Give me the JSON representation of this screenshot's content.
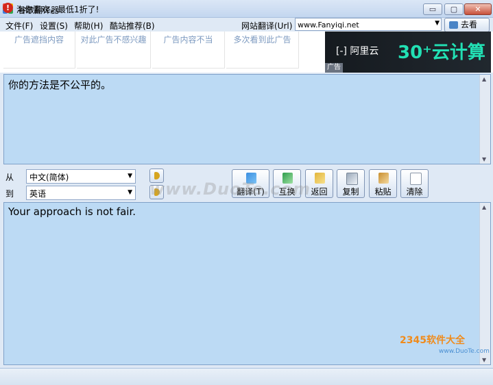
{
  "window": {
    "title": "谷歌翻译器",
    "controls": {
      "minimize": "▭",
      "restore": "▢",
      "close": "✕"
    }
  },
  "menu": {
    "items": [
      "文件(F)",
      "设置(S)",
      "帮助(H)",
      "酷站推荐(B)"
    ],
    "url_label": "网站翻译(Url)",
    "url_value": "www.Fanyiqi.net",
    "go_label": "去看"
  },
  "ads": {
    "links": [
      "广告遮挡内容",
      "对此广告不感兴趣",
      "广告内容不当",
      "多次看到此广告"
    ],
    "banner_logo": "[-] 阿里云",
    "banner_headline": "30⁺云计算",
    "tag": "广告"
  },
  "source": {
    "text": "你的方法是不公平的。"
  },
  "languages": {
    "from_label": "从",
    "to_label": "到",
    "from_value": "中文(简体)",
    "to_value": "英语"
  },
  "toolbar": {
    "buttons": [
      {
        "label": "翻译(T)",
        "icon": "translate-icon"
      },
      {
        "label": "互换",
        "icon": "swap-icon"
      },
      {
        "label": "返回",
        "icon": "back-icon"
      },
      {
        "label": "复制",
        "icon": "copy-icon"
      },
      {
        "label": "粘贴",
        "icon": "paste-icon"
      },
      {
        "label": "清除",
        "icon": "clear-icon"
      }
    ]
  },
  "result": {
    "text": "Your approach is not fair."
  },
  "watermark": "www.DuoTe.com",
  "status": {
    "text": "淘你喜欢，最低1折了!"
  },
  "corner": {
    "logo": "2345软件大全",
    "url": "www.DuoTe.com"
  },
  "colors": {
    "textarea_bg": "#bcdaf4",
    "ad_text": "#7d9ac0",
    "ad_accent": "#22e0b4"
  }
}
